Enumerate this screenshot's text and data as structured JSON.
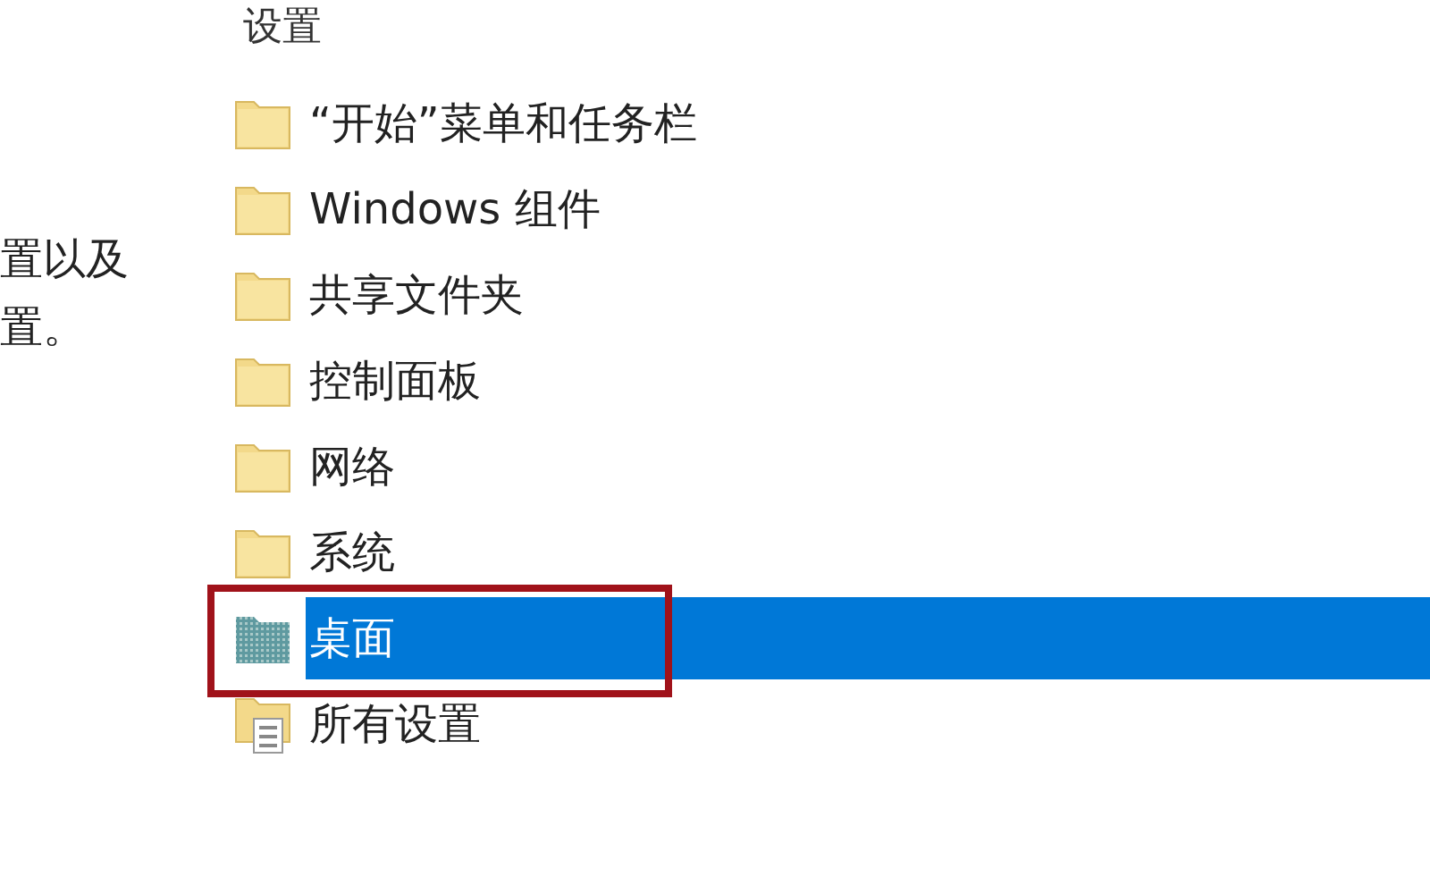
{
  "description": {
    "lines": [
      "置以及",
      "置。"
    ]
  },
  "settings": {
    "header": "设置",
    "items": [
      {
        "label": "“开始”菜单和任务栏",
        "kind": "folder",
        "selected": false,
        "highlighted": false
      },
      {
        "label": "Windows 组件",
        "kind": "folder",
        "selected": false,
        "highlighted": false
      },
      {
        "label": "共享文件夹",
        "kind": "folder",
        "selected": false,
        "highlighted": false
      },
      {
        "label": "控制面板",
        "kind": "folder",
        "selected": false,
        "highlighted": false
      },
      {
        "label": "网络",
        "kind": "folder",
        "selected": false,
        "highlighted": false
      },
      {
        "label": "系统",
        "kind": "folder",
        "selected": false,
        "highlighted": false
      },
      {
        "label": "桌面",
        "kind": "shaded-folder",
        "selected": true,
        "highlighted": true
      },
      {
        "label": "所有设置",
        "kind": "all-settings",
        "selected": false,
        "highlighted": false
      }
    ]
  }
}
